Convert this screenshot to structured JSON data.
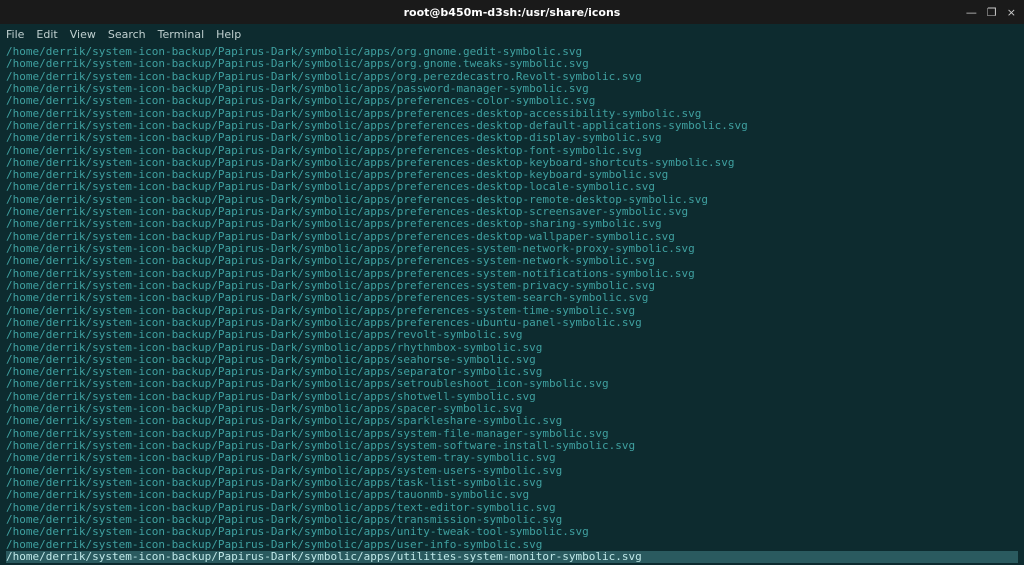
{
  "window": {
    "title": "root@b450m-d3sh:/usr/share/icons",
    "controls": {
      "minimize": "—",
      "maximize": "❐",
      "close": "×"
    }
  },
  "menubar": {
    "items": [
      "File",
      "Edit",
      "View",
      "Search",
      "Terminal",
      "Help"
    ]
  },
  "terminal": {
    "path_prefix": "/home/derrik/system-icon-backup/Papirus-Dark/symbolic/apps/",
    "files": [
      "org.gnome.gedit-symbolic.svg",
      "org.gnome.tweaks-symbolic.svg",
      "org.perezdecastro.Revolt-symbolic.svg",
      "password-manager-symbolic.svg",
      "preferences-color-symbolic.svg",
      "preferences-desktop-accessibility-symbolic.svg",
      "preferences-desktop-default-applications-symbolic.svg",
      "preferences-desktop-display-symbolic.svg",
      "preferences-desktop-font-symbolic.svg",
      "preferences-desktop-keyboard-shortcuts-symbolic.svg",
      "preferences-desktop-keyboard-symbolic.svg",
      "preferences-desktop-locale-symbolic.svg",
      "preferences-desktop-remote-desktop-symbolic.svg",
      "preferences-desktop-screensaver-symbolic.svg",
      "preferences-desktop-sharing-symbolic.svg",
      "preferences-desktop-wallpaper-symbolic.svg",
      "preferences-system-network-proxy-symbolic.svg",
      "preferences-system-network-symbolic.svg",
      "preferences-system-notifications-symbolic.svg",
      "preferences-system-privacy-symbolic.svg",
      "preferences-system-search-symbolic.svg",
      "preferences-system-time-symbolic.svg",
      "preferences-ubuntu-panel-symbolic.svg",
      "revolt-symbolic.svg",
      "rhythmbox-symbolic.svg",
      "seahorse-symbolic.svg",
      "separator-symbolic.svg",
      "setroubleshoot_icon-symbolic.svg",
      "shotwell-symbolic.svg",
      "spacer-symbolic.svg",
      "sparkleshare-symbolic.svg",
      "system-file-manager-symbolic.svg",
      "system-software-install-symbolic.svg",
      "system-tray-symbolic.svg",
      "system-users-symbolic.svg",
      "task-list-symbolic.svg",
      "tauonmb-symbolic.svg",
      "text-editor-symbolic.svg",
      "transmission-symbolic.svg",
      "unity-tweak-tool-symbolic.svg",
      "user-info-symbolic.svg",
      "utilities-system-monitor-symbolic.svg"
    ],
    "highlighted_index": 41
  }
}
